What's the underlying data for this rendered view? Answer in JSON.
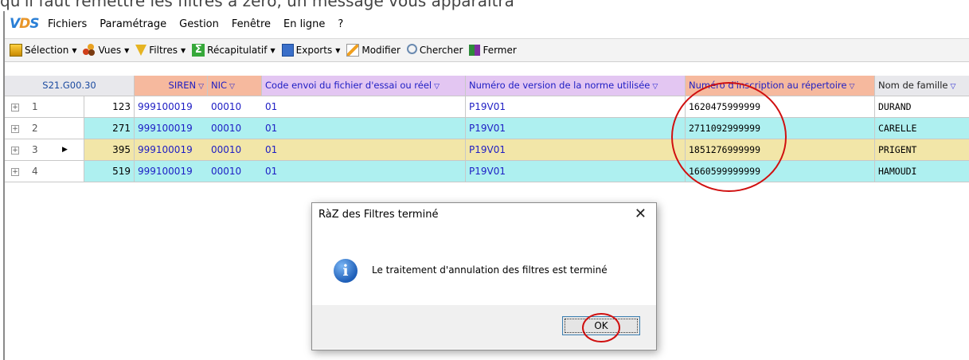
{
  "top_strip_text": "qu'il faut remettre les filtres à zero, un message vous apparaitra",
  "menubar": {
    "items": [
      "Fichiers",
      "Paramétrage",
      "Gestion",
      "Fenêtre",
      "En ligne",
      "?"
    ]
  },
  "toolbar": {
    "selection": "Sélection",
    "vues": "Vues",
    "filtres": "Filtres",
    "recap": "Récapitulatif",
    "exports": "Exports",
    "modifier": "Modifier",
    "chercher": "Chercher",
    "fermer": "Fermer"
  },
  "grid": {
    "headers": {
      "s21": "S21.G00.30",
      "siren": "SIREN",
      "nic": "NIC",
      "code": "Code envoi du fichier d'essai ou réel",
      "numero": "Numéro de version de la norme utilisée",
      "inscription": "Numéro d'inscription au répertoire",
      "nom": "Nom de famille"
    },
    "rows": [
      {
        "index": "1",
        "value": "123",
        "siren": "999100019",
        "nic": "00010",
        "code": "01",
        "numero": "P19V01",
        "inscription": "1620475999999",
        "nom": "DURAND"
      },
      {
        "index": "2",
        "value": "271",
        "siren": "999100019",
        "nic": "00010",
        "code": "01",
        "numero": "P19V01",
        "inscription": "2711092999999",
        "nom": "CARELLE"
      },
      {
        "index": "3",
        "value": "395",
        "siren": "999100019",
        "nic": "00010",
        "code": "01",
        "numero": "P19V01",
        "inscription": "1851276999999",
        "nom": "PRIGENT"
      },
      {
        "index": "4",
        "value": "519",
        "siren": "999100019",
        "nic": "00010",
        "code": "01",
        "numero": "P19V01",
        "inscription": "1660599999999",
        "nom": "HAMOUDI"
      }
    ]
  },
  "dialog": {
    "title": "RàZ des Filtres terminé",
    "message": "Le traitement d'annulation des filtres est terminé",
    "ok": "OK"
  },
  "colors": {
    "annotation": "#d01010",
    "header_orange": "#f6b99e",
    "header_purple": "#e3c6f2",
    "row_cyan": "#aef0f0",
    "row_yellow": "#f2e6a8"
  }
}
